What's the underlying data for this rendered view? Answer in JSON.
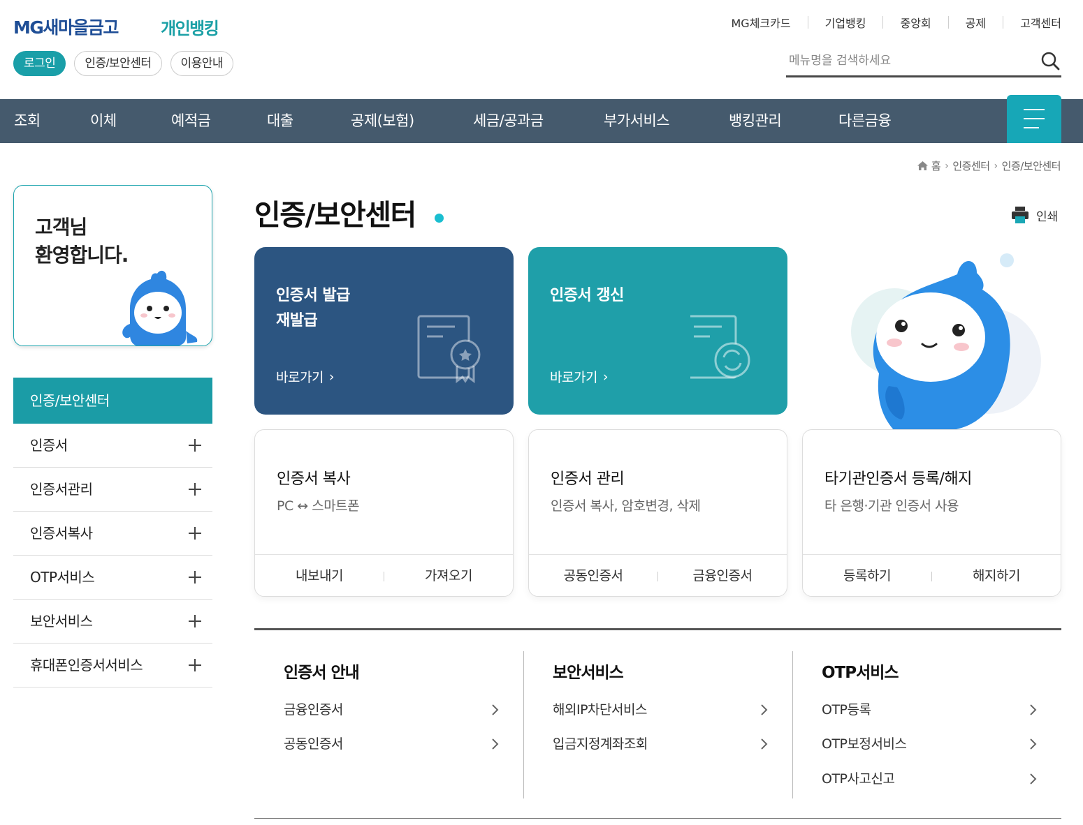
{
  "header": {
    "logo": "MG새마을금고",
    "service_title": "개인뱅킹",
    "top_links": [
      "MG체크카드",
      "기업뱅킹",
      "중앙회",
      "공제",
      "고객센터"
    ],
    "pills": {
      "login": "로그인",
      "security_center": "인증/보안센터",
      "guide": "이용안내"
    },
    "search": {
      "placeholder": "메뉴명을 검색하세요"
    }
  },
  "gnb": {
    "items": [
      "조회",
      "이체",
      "예적금",
      "대출",
      "공제(보험)",
      "세금/공과금",
      "부가서비스",
      "뱅킹관리",
      "다른금융"
    ]
  },
  "breadcrumb": [
    "홈",
    "인증센터",
    "인증/보안센터"
  ],
  "welcome": {
    "line1": "고객님",
    "line2": "환영합니다."
  },
  "sidebar": {
    "title": "인증/보안센터",
    "items": [
      "인증서",
      "인증서관리",
      "인증서복사",
      "OTP서비스",
      "보안서비스",
      "휴대폰인증서서비스"
    ]
  },
  "page": {
    "title": "인증/보안센터",
    "print_label": "인쇄"
  },
  "big_cards": [
    {
      "line1": "인증서 발급",
      "line2": "재발급",
      "go": "바로가기",
      "color": "#2c5581"
    },
    {
      "line1": "인증서 갱신",
      "line2": "",
      "go": "바로가기",
      "color": "#1f9fa9"
    }
  ],
  "feature_cards": [
    {
      "title": "인증서 복사",
      "subtitle": "PC ↔ 스마트폰",
      "actions": [
        "내보내기",
        "가져오기"
      ]
    },
    {
      "title": "인증서 관리",
      "subtitle": "인증서 복사, 암호변경, 삭제",
      "actions": [
        "공동인증서",
        "금융인증서"
      ]
    },
    {
      "title": "타기관인증서 등록/해지",
      "subtitle": "타 은행·기관 인증서 사용",
      "actions": [
        "등록하기",
        "해지하기"
      ]
    }
  ],
  "sections": [
    {
      "title": "인증서 안내",
      "links": [
        "금융인증서",
        "공동인증서"
      ]
    },
    {
      "title": "보안서비스",
      "links": [
        "해외IP차단서비스",
        "입금지정계좌조회"
      ]
    },
    {
      "title": "OTP서비스",
      "links": [
        "OTP등록",
        "OTP보정서비스",
        "OTP사고신고"
      ]
    }
  ],
  "colors": {
    "accent": "#1a9fa8",
    "gnb": "#455a6d",
    "navy_card": "#2c5581",
    "teal_card": "#1f9fa9"
  }
}
